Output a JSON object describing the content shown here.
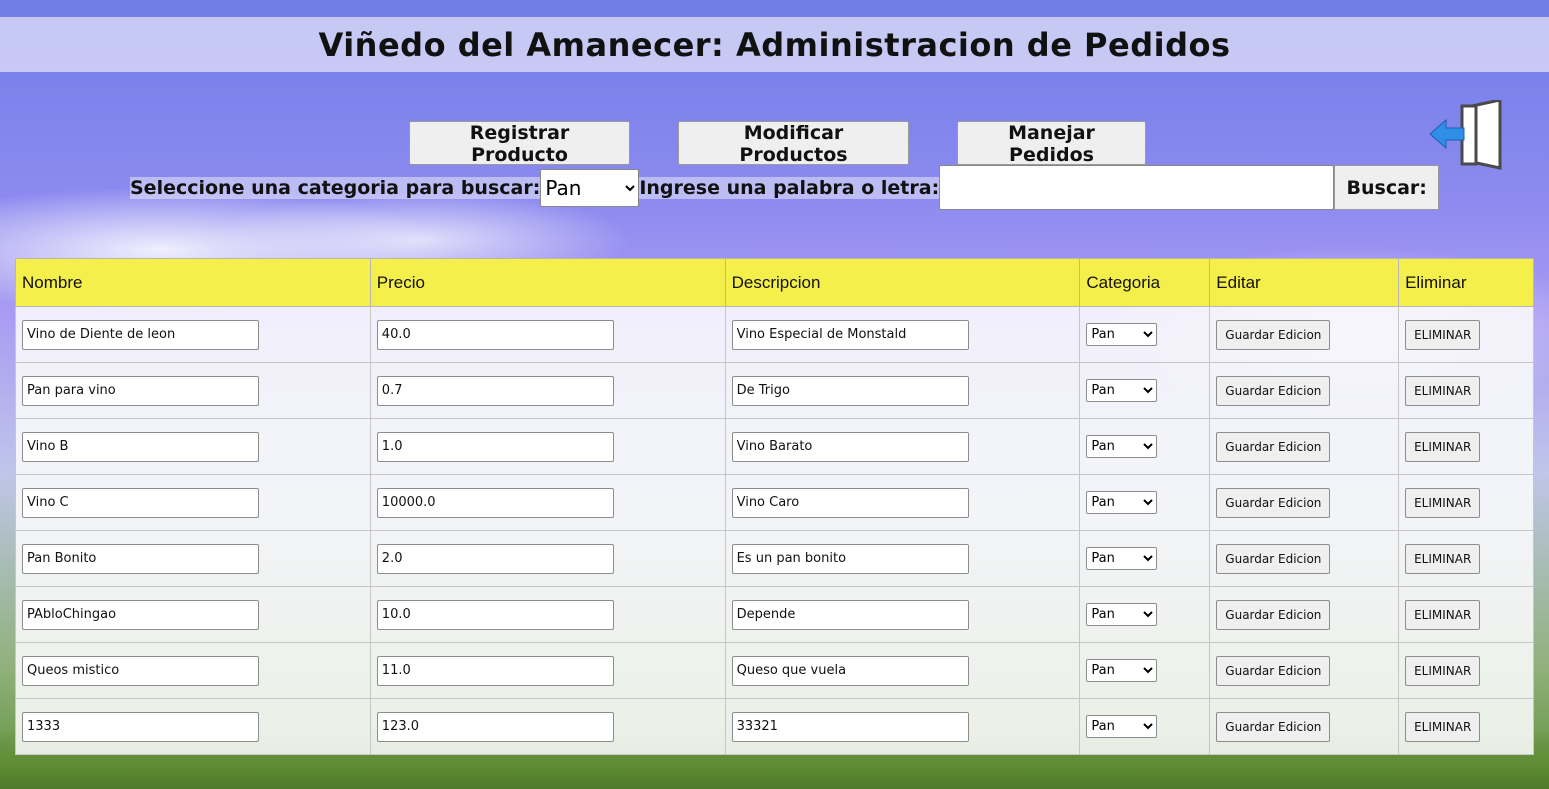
{
  "header": {
    "title": "Viñedo del Amanecer: Administracion de Pedidos"
  },
  "nav": {
    "register_label": "Registrar Producto",
    "modify_label": "Modificar Productos",
    "orders_label": "Manejar Pedidos",
    "logout_icon": "logout-door-arrow-icon"
  },
  "search": {
    "category_label": "Seleccione una categoria para buscar:",
    "category_value": "Pan",
    "keyword_label": "Ingrese una palabra o letra:",
    "keyword_value": "",
    "button_label": "Buscar:"
  },
  "table": {
    "headers": [
      "Nombre",
      "Precio",
      "Descripcion",
      "Categoria",
      "Editar",
      "Eliminar"
    ],
    "rows": [
      {
        "nombre": "Vino de Diente de leon",
        "precio": "40.0",
        "descripcion": "Vino Especial de Monstald",
        "categoria": "Pan",
        "editar": "Guardar Edicion",
        "eliminar": "ELIMINAR"
      },
      {
        "nombre": "Pan para vino",
        "precio": "0.7",
        "descripcion": "De Trigo",
        "categoria": "Pan",
        "editar": "Guardar Edicion",
        "eliminar": "ELIMINAR"
      },
      {
        "nombre": "Vino B",
        "precio": "1.0",
        "descripcion": "Vino Barato",
        "categoria": "Pan",
        "editar": "Guardar Edicion",
        "eliminar": "ELIMINAR"
      },
      {
        "nombre": "Vino C",
        "precio": "10000.0",
        "descripcion": "Vino Caro",
        "categoria": "Pan",
        "editar": "Guardar Edicion",
        "eliminar": "ELIMINAR"
      },
      {
        "nombre": "Pan Bonito",
        "precio": "2.0",
        "descripcion": "Es un pan bonito",
        "categoria": "Pan",
        "editar": "Guardar Edicion",
        "eliminar": "ELIMINAR"
      },
      {
        "nombre": "PAbloChingao",
        "precio": "10.0",
        "descripcion": "Depende",
        "categoria": "Pan",
        "editar": "Guardar Edicion",
        "eliminar": "ELIMINAR"
      },
      {
        "nombre": "Queos mistico",
        "precio": "11.0",
        "descripcion": "Queso que vuela",
        "categoria": "Pan",
        "editar": "Guardar Edicion",
        "eliminar": "ELIMINAR"
      },
      {
        "nombre": "1333",
        "precio": "123.0",
        "descripcion": "33321",
        "categoria": "Pan",
        "editar": "Guardar Edicion",
        "eliminar": "ELIMINAR"
      }
    ]
  },
  "colors": {
    "header_row": "#f5ef4b",
    "logout_arrow": "#2f8fe8"
  }
}
